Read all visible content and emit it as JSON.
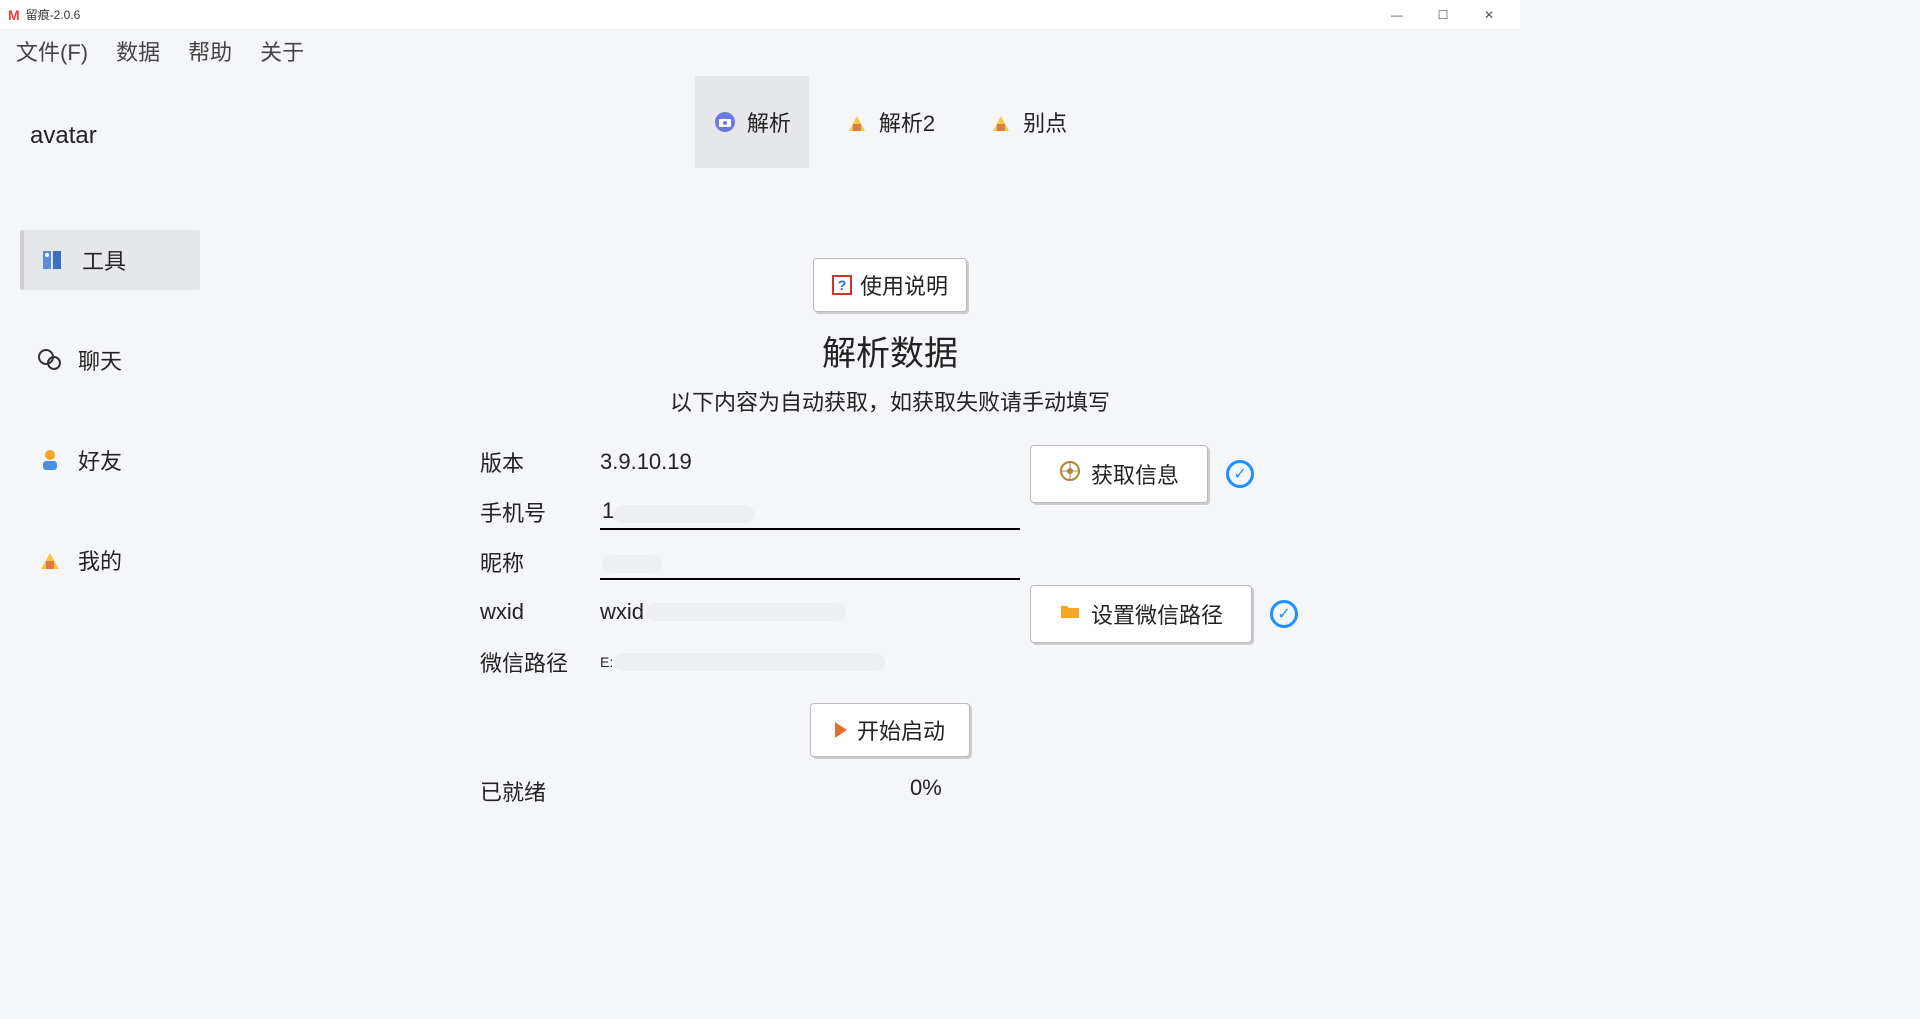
{
  "window": {
    "logo": "M",
    "title": "留痕-2.0.6"
  },
  "menu": {
    "file": "文件(F)",
    "data": "数据",
    "help": "帮助",
    "about": "关于"
  },
  "sidebar": {
    "avatar": "avatar",
    "items": [
      {
        "label": "工具"
      },
      {
        "label": "聊天"
      },
      {
        "label": "好友"
      },
      {
        "label": "我的"
      }
    ]
  },
  "tabs": [
    {
      "label": "解析"
    },
    {
      "label": "解析2"
    },
    {
      "label": "别点"
    }
  ],
  "help_button": "使用说明",
  "section": {
    "title": "解析数据",
    "subtitle": "以下内容为自动获取，如获取失败请手动填写"
  },
  "form": {
    "version_label": "版本",
    "version_value": "3.9.10.19",
    "phone_label": "手机号",
    "phone_value": "1",
    "nick_label": "昵称",
    "nick_value": "",
    "wxid_label": "wxid",
    "wxid_value": "wxid",
    "path_label": "微信路径",
    "path_value": "E:"
  },
  "buttons": {
    "get_info": "获取信息",
    "set_path": "设置微信路径",
    "start": "开始启动"
  },
  "status": {
    "ready": "已就绪",
    "progress": "0%"
  }
}
